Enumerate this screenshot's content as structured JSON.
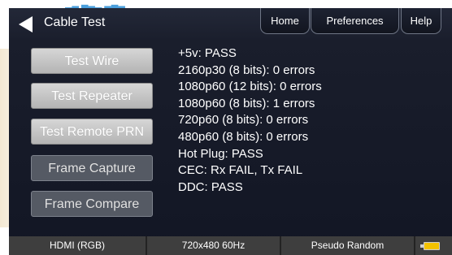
{
  "header": {
    "title": "Cable Test",
    "tabs": [
      {
        "label": "Home"
      },
      {
        "label": "Preferences"
      },
      {
        "label": "Help"
      }
    ]
  },
  "sidebar": {
    "buttons": [
      {
        "label": "Test Wire",
        "state": "normal"
      },
      {
        "label": "Test Repeater",
        "state": "normal"
      },
      {
        "label": "Test Remote PRN",
        "state": "normal"
      },
      {
        "label": "Frame Capture",
        "state": "disabled"
      },
      {
        "label": "Frame Compare",
        "state": "disabled"
      }
    ]
  },
  "results": [
    "+5v: PASS",
    "2160p30 (8 bits): 0 errors",
    "1080p60 (12 bits): 0 errors",
    "1080p60 (8 bits): 1 errors",
    "720p60 (8 bits): 0 errors",
    "480p60 (8 bits): 0 errors",
    "Hot Plug: PASS",
    "CEC: Rx FAIL, Tx FAIL",
    "DDC: PASS"
  ],
  "status_bar": {
    "interface": "HDMI (RGB)",
    "resolution": "720x480 60Hz",
    "pattern": "Pseudo Random",
    "battery_icon": "battery-icon"
  },
  "colors": {
    "screen_bg": "#1b1f2d",
    "button_enabled": "#c8c8c8",
    "button_disabled": "#555a64",
    "status_bar_bg": "#3e3e3e",
    "battery": "#f3c200"
  }
}
